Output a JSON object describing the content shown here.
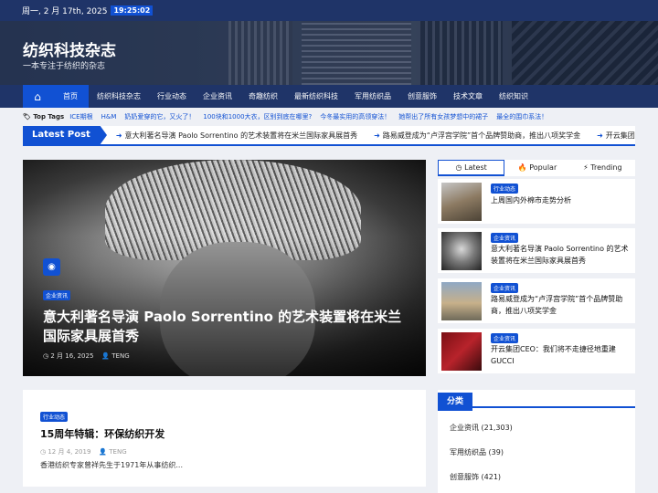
{
  "topbar": {
    "date": "周一, 2 月 17th, 2025",
    "time": "19:25:02"
  },
  "site": {
    "title": "纺织科技杂志",
    "description": "一本专注于纺织的杂志"
  },
  "nav": {
    "items": [
      "首页",
      "纺织科技杂志",
      "行业动态",
      "企业资讯",
      "奇趣纺织",
      "最新纺织科技",
      "军用纺织品",
      "创意服饰",
      "技术文章",
      "纺织知识"
    ]
  },
  "top_tags": {
    "label": "Top Tags",
    "tags": [
      "ICE期根",
      "H&M",
      "奶奶爱穿的它，又火了！",
      "100块和1000大衣，区别到底在哪里?",
      "今冬最实用的高领穿法！",
      "她帮出了所有女孩梦想中的裙子",
      "最全的围巾系法！"
    ]
  },
  "ticker": {
    "label": "Latest Post",
    "items": [
      "意大利著名导演 Paolo Sorrentino 的艺术装置将在米兰国际家具展首秀",
      "路易威登成为“卢浮宫学院”首个品牌赞助商，推出八项奖学金",
      "开云集团CEO：我"
    ]
  },
  "hero": {
    "category": "企业资讯",
    "title": "意大利著名导演 Paolo Sorrentino 的艺术装置将在米兰国际家具展首秀",
    "date": "2 月 16, 2025",
    "author": "TENG"
  },
  "post": {
    "category": "行业动态",
    "title": "15周年特辑：环保纺织开发",
    "date": "12 月 4, 2019",
    "author": "TENG",
    "excerpt": "香港纺织专家曾祥先生于1971年从事纺织..."
  },
  "sidebar": {
    "tabs": [
      "Latest",
      "Popular",
      "Trending"
    ],
    "posts": [
      {
        "category": "行业动态",
        "title": "上周国内外棉市走势分析"
      },
      {
        "category": "企业资讯",
        "title": "意大利著名导演 Paolo Sorrentino 的艺术装置将在米兰国际家具展首秀"
      },
      {
        "category": "企业资讯",
        "title": "路易威登成为“卢浮宫学院”首个品牌赞助商，推出八项奖学金"
      },
      {
        "category": "企业资讯",
        "title": "开云集团CEO：我们将不走捷径地重建GUCCI"
      }
    ]
  },
  "categories": {
    "heading": "分类",
    "items": [
      "企业资讯 (21,303)",
      "军用纺织品 (39)",
      "创意服饰 (421)"
    ]
  },
  "colors": {
    "navy": "#1f3468",
    "accent": "#1151d3",
    "background": "#eef0f5"
  }
}
